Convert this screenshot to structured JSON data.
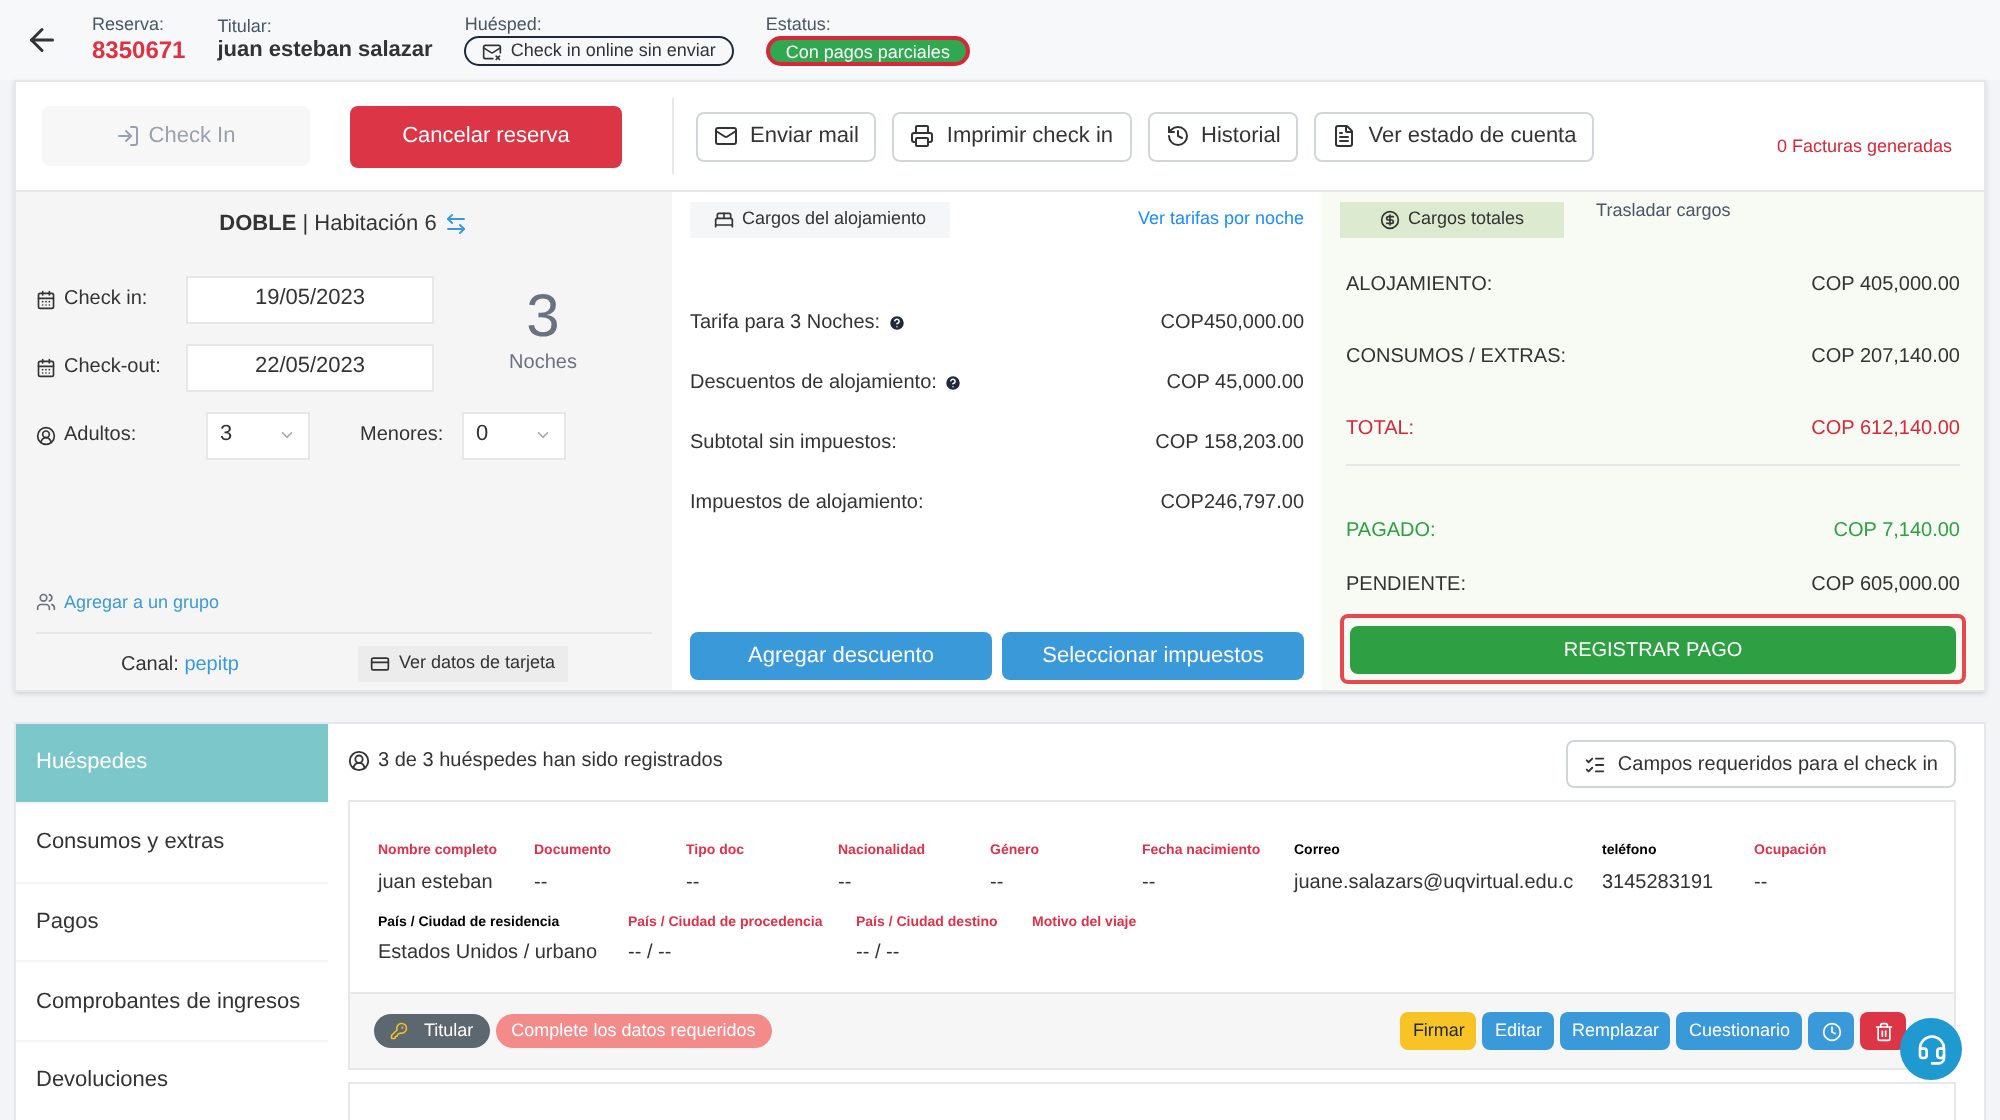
{
  "header": {
    "reserva_label": "Reserva:",
    "reserva": "8350671",
    "titular_label": "Titular:",
    "titular": "juan esteban salazar",
    "huesped_label": "Huésped:",
    "huesped_status": "Check in online sin enviar",
    "estatus_label": "Estatus:",
    "estatus": "Con pagos parciales"
  },
  "actions": {
    "check_in": {
      "label": "Check In",
      "disabled": true
    },
    "cancel": "Cancelar reserva",
    "buttons": [
      {
        "kind": "mail",
        "label": "Enviar mail"
      },
      {
        "kind": "print",
        "label": "Imprimir check in"
      },
      {
        "kind": "history",
        "label": "Historial"
      },
      {
        "kind": "statement",
        "label": "Ver estado de cuenta"
      }
    ],
    "invoices": "0 Facturas generadas"
  },
  "room": {
    "type": "DOBLE",
    "separator": "|",
    "name": "Habitación 6",
    "check_in_label": "Check in:",
    "check_in": "19/05/2023",
    "check_out_label": "Check-out:",
    "check_out": "22/05/2023",
    "nights": "3",
    "nights_label": "Noches",
    "adults_label": "Adultos:",
    "adults": "3",
    "minors_label": "Menores:",
    "minors": "0",
    "group_link": "Agregar a un grupo",
    "channel_label": "Canal:",
    "channel": "pepitp",
    "card_button": "Ver datos de tarjeta"
  },
  "charges": {
    "tabs": [
      {
        "label": "Cargos del alojamiento",
        "selected": false
      }
    ],
    "rates_link": "Ver tarifas por noche",
    "rows": [
      {
        "label": "Tarifa para 3 Noches:",
        "help": true,
        "value": "COP450,000.00"
      },
      {
        "label": "Descuentos de alojamiento:",
        "help": true,
        "value": "COP 45,000.00"
      },
      {
        "label": "Subtotal sin impuestos:",
        "help": false,
        "value": "COP 158,203.00"
      },
      {
        "label": "Impuestos de alojamiento:",
        "help": false,
        "value": "COP246,797.00"
      }
    ],
    "buttons": [
      "Agregar descuento",
      "Seleccionar impuestos"
    ]
  },
  "summary": {
    "tabs": [
      {
        "label": "Cargos totales",
        "selected": true
      },
      {
        "label": "Trasladar cargos",
        "selected": false
      }
    ],
    "rows": [
      {
        "kind": "normal",
        "label": "ALOJAMIENTO:",
        "value": "COP 405,000.00"
      },
      {
        "kind": "normal",
        "label": "CONSUMOS / EXTRAS:",
        "value": "COP 207,140.00"
      },
      {
        "kind": "total",
        "label": "TOTAL:",
        "value": "COP 612,140.00"
      },
      {
        "kind": "paid",
        "label": "PAGADO:",
        "value": "COP 7,140.00"
      },
      {
        "kind": "normal",
        "label": "PENDIENTE:",
        "value": "COP 605,000.00"
      }
    ],
    "pay_button": "REGISTRAR PAGO"
  },
  "sidebar": {
    "items": [
      {
        "label": "Huéspedes",
        "selected": true
      },
      {
        "label": "Consumos y extras",
        "selected": false
      },
      {
        "label": "Pagos",
        "selected": false
      },
      {
        "label": "Comprobantes de ingresos",
        "selected": false
      },
      {
        "label": "Devoluciones",
        "selected": false
      }
    ]
  },
  "guests": {
    "count_text": "3 de 3 huéspedes han sido registrados",
    "required_button": "Campos requeridos para el check in",
    "card": {
      "row_1": [
        {
          "label": "Nombre completo",
          "missing": true,
          "value": "juan esteban"
        },
        {
          "label": "Documento",
          "missing": true,
          "value": "--"
        },
        {
          "label": "Tipo doc",
          "missing": true,
          "value": "--"
        },
        {
          "label": "Nacionalidad",
          "missing": true,
          "value": "--"
        },
        {
          "label": "Género",
          "missing": true,
          "value": "--"
        },
        {
          "label": "Fecha nacimiento",
          "missing": true,
          "value": "--"
        },
        {
          "label": "Correo",
          "missing": false,
          "value": "juane.salazars@uqvirtual.edu.c"
        },
        {
          "label": "teléfono",
          "missing": false,
          "value": "3145283191"
        },
        {
          "label": "Ocupación",
          "missing": true,
          "value": "--"
        }
      ],
      "row_2": [
        {
          "label": "País / Ciudad de residencia",
          "missing": false,
          "value": "Estados Unidos / urbano"
        },
        {
          "label": "País / Ciudad de procedencia",
          "missing": true,
          "value": "-- / --"
        },
        {
          "label": "País / Ciudad destino",
          "missing": true,
          "value": "-- / --"
        },
        {
          "label": "Motivo del viaje",
          "missing": true
        }
      ],
      "badges": [
        {
          "kind": "holder",
          "label": "Titular"
        },
        {
          "kind": "warning",
          "label": "Complete los datos requeridos"
        }
      ],
      "buttons": [
        {
          "kind": "text",
          "label": "Firmar",
          "color": "#f7c325"
        },
        {
          "kind": "text",
          "label": "Editar",
          "color": "#3a9ad9"
        },
        {
          "kind": "text",
          "label": "Remplazar",
          "color": "#3a9ad9"
        },
        {
          "kind": "text",
          "label": "Cuestionario",
          "color": "#3a9ad9"
        },
        {
          "kind": "history",
          "color": "#3a9ad9"
        },
        {
          "kind": "delete",
          "color": "#dc3545"
        }
      ]
    }
  }
}
